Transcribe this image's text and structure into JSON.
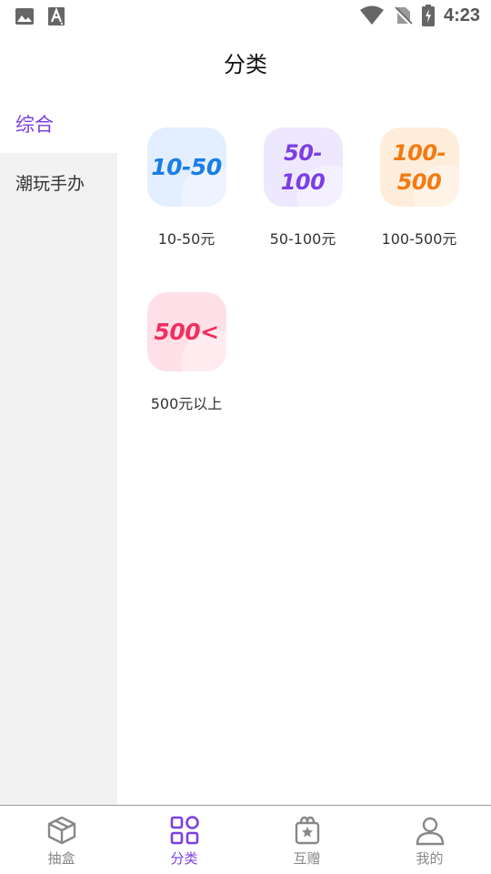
{
  "status_bar": {
    "time": "4:23",
    "left_icons": [
      "image-icon",
      "text-a-icon"
    ],
    "right_icons": [
      "wifi-icon",
      "no-sim-icon",
      "battery-charging-icon"
    ]
  },
  "header": {
    "title": "分类"
  },
  "sidebar": {
    "items": [
      {
        "label": "综合",
        "active": true
      },
      {
        "label": "潮玩手办",
        "active": false
      }
    ]
  },
  "grid": {
    "items": [
      {
        "tile_line1": "10-50",
        "tile_line2": "",
        "label": "10-50元",
        "tile_bg": "#e3efff",
        "tile_color": "#1a7de6"
      },
      {
        "tile_line1": "50-",
        "tile_line2": "100",
        "label": "50-100元",
        "tile_bg": "#eee8ff",
        "tile_color": "#7b3fe4"
      },
      {
        "tile_line1": "100-",
        "tile_line2": "500",
        "label": "100-500元",
        "tile_bg": "#ffeddc",
        "tile_color": "#f47a10"
      },
      {
        "tile_line1": "500<",
        "tile_line2": "",
        "label": "500元以上",
        "tile_bg": "#ffe0e8",
        "tile_color": "#f0305f"
      }
    ]
  },
  "bottom_nav": {
    "items": [
      {
        "label": "抽盒",
        "icon": "box-icon",
        "active": false
      },
      {
        "label": "分类",
        "icon": "grid-icon",
        "active": true
      },
      {
        "label": "互赠",
        "icon": "gift-icon",
        "active": false
      },
      {
        "label": "我的",
        "icon": "user-icon",
        "active": false
      }
    ]
  },
  "colors": {
    "accent": "#7b3fe4",
    "sidebar_bg": "#f2f2f2",
    "inactive_nav": "#888888"
  }
}
